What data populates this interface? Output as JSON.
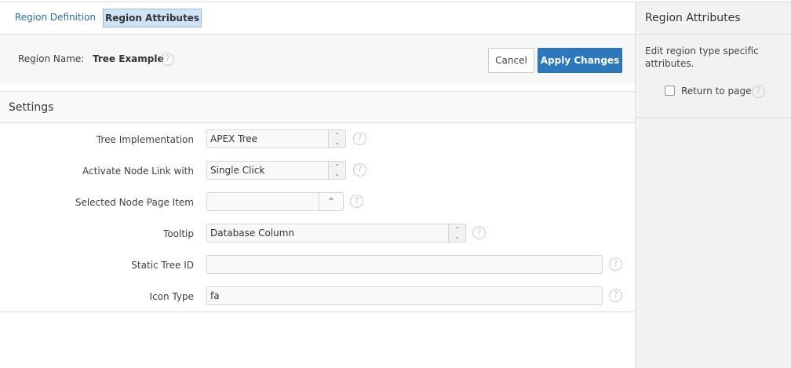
{
  "tabs": {
    "region_definition": "Region Definition",
    "region_attributes": "Region Attributes"
  },
  "region": {
    "label": "Region Name:",
    "value": "Tree Example"
  },
  "buttons": {
    "cancel": "Cancel",
    "apply": "Apply Changes"
  },
  "settings": {
    "title": "Settings",
    "fields": [
      {
        "label": "Tree Implementation",
        "value": "APEX Tree"
      },
      {
        "label": "Activate Node Link with",
        "value": "Single Click"
      },
      {
        "label": "Selected Node Page Item",
        "value": ""
      },
      {
        "label": "Tooltip",
        "value": "Database Column"
      },
      {
        "label": "Static Tree ID",
        "value": ""
      },
      {
        "label": "Icon Type",
        "value": "fa"
      }
    ]
  },
  "help_glyph": "?",
  "sidebar": {
    "title": "Region Attributes",
    "description": "Edit region type specific attributes.",
    "return_to_page": "Return to page",
    "return_checked": false
  }
}
